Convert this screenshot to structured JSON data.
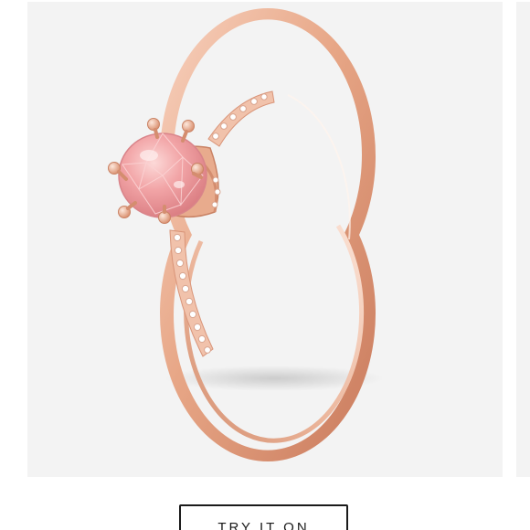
{
  "gallery": {
    "image_subject": "rose-gold-pink-crown-solitaire-ring",
    "next_icon": "chevron-right-icon",
    "colors": {
      "background": "#f3f3f3",
      "rose_gold": "#e8a585",
      "pink_stone": "#f0a4a8"
    }
  },
  "actions": {
    "try_on_label": "TRY IT ON"
  }
}
